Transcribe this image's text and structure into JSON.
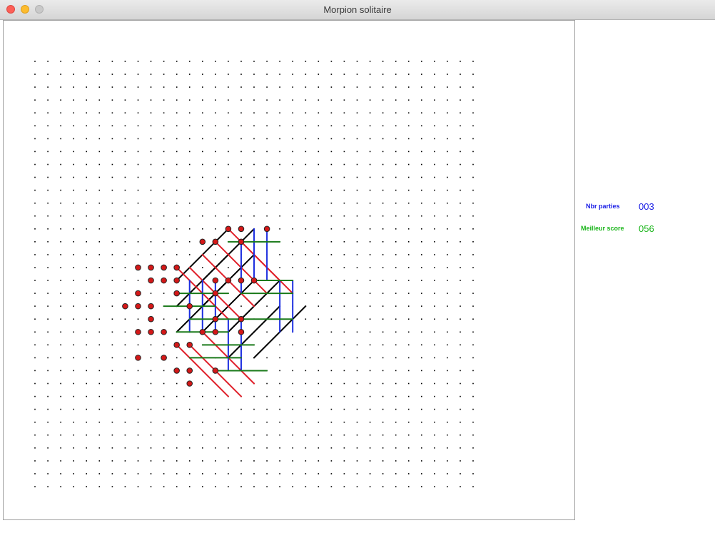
{
  "window": {
    "title": "Morpion solitaire"
  },
  "stats": {
    "games_label": "Nbr parties",
    "games_value": "003",
    "best_label": "Meilleur score",
    "best_value": "056"
  },
  "colors": {
    "games": "#1c20e6",
    "best": "#1bb51b",
    "line_vertical": "#1c2ee0",
    "line_horizontal": "#1a7a1a",
    "line_diag_down": "#e0202a",
    "line_diag_up": "#000000",
    "point_fill": "#d41818"
  },
  "board": {
    "grid_cols": 35,
    "grid_rows": 34,
    "lines": [
      {
        "from": [
          11,
          17
        ],
        "to": [
          15,
          13
        ],
        "dir": "diag-up"
      },
      {
        "from": [
          11,
          19
        ],
        "to": [
          15,
          15
        ],
        "dir": "diag-up"
      },
      {
        "from": [
          11,
          21
        ],
        "to": [
          15,
          17
        ],
        "dir": "diag-up"
      },
      {
        "from": [
          13,
          17
        ],
        "to": [
          17,
          13
        ],
        "dir": "diag-up"
      },
      {
        "from": [
          13,
          19
        ],
        "to": [
          17,
          15
        ],
        "dir": "diag-up"
      },
      {
        "from": [
          13,
          21
        ],
        "to": [
          17,
          17
        ],
        "dir": "diag-up"
      },
      {
        "from": [
          15,
          21
        ],
        "to": [
          19,
          17
        ],
        "dir": "diag-up"
      },
      {
        "from": [
          15,
          23
        ],
        "to": [
          19,
          19
        ],
        "dir": "diag-up"
      },
      {
        "from": [
          17,
          23
        ],
        "to": [
          21,
          19
        ],
        "dir": "diag-up"
      },
      {
        "from": [
          11,
          16
        ],
        "to": [
          15,
          20
        ],
        "dir": "diag-down"
      },
      {
        "from": [
          12,
          16
        ],
        "to": [
          16,
          20
        ],
        "dir": "diag-down"
      },
      {
        "from": [
          13,
          15
        ],
        "to": [
          17,
          19
        ],
        "dir": "diag-down"
      },
      {
        "from": [
          14,
          14
        ],
        "to": [
          18,
          18
        ],
        "dir": "diag-down"
      },
      {
        "from": [
          15,
          13
        ],
        "to": [
          19,
          17
        ],
        "dir": "diag-down"
      },
      {
        "from": [
          16,
          14
        ],
        "to": [
          20,
          18
        ],
        "dir": "diag-down"
      },
      {
        "from": [
          11,
          22
        ],
        "to": [
          15,
          26
        ],
        "dir": "diag-down"
      },
      {
        "from": [
          12,
          22
        ],
        "to": [
          16,
          26
        ],
        "dir": "diag-down"
      },
      {
        "from": [
          13,
          21
        ],
        "to": [
          17,
          25
        ],
        "dir": "diag-down"
      },
      {
        "from": [
          17,
          13
        ],
        "to": [
          17,
          17
        ],
        "dir": "vertical"
      },
      {
        "from": [
          16,
          14
        ],
        "to": [
          16,
          18
        ],
        "dir": "vertical"
      },
      {
        "from": [
          18,
          13
        ],
        "to": [
          18,
          17
        ],
        "dir": "vertical"
      },
      {
        "from": [
          12,
          17
        ],
        "to": [
          12,
          21
        ],
        "dir": "vertical"
      },
      {
        "from": [
          13,
          17
        ],
        "to": [
          13,
          21
        ],
        "dir": "vertical"
      },
      {
        "from": [
          14,
          17
        ],
        "to": [
          14,
          21
        ],
        "dir": "vertical"
      },
      {
        "from": [
          15,
          20
        ],
        "to": [
          15,
          24
        ],
        "dir": "vertical"
      },
      {
        "from": [
          16,
          20
        ],
        "to": [
          16,
          24
        ],
        "dir": "vertical"
      },
      {
        "from": [
          19,
          17
        ],
        "to": [
          19,
          21
        ],
        "dir": "vertical"
      },
      {
        "from": [
          20,
          17
        ],
        "to": [
          20,
          21
        ],
        "dir": "vertical"
      },
      {
        "from": [
          15,
          14
        ],
        "to": [
          19,
          14
        ],
        "dir": "horizontal"
      },
      {
        "from": [
          11,
          18
        ],
        "to": [
          15,
          18
        ],
        "dir": "horizontal"
      },
      {
        "from": [
          16,
          18
        ],
        "to": [
          20,
          18
        ],
        "dir": "horizontal"
      },
      {
        "from": [
          10,
          19
        ],
        "to": [
          14,
          19
        ],
        "dir": "horizontal"
      },
      {
        "from": [
          12,
          20
        ],
        "to": [
          16,
          20
        ],
        "dir": "horizontal"
      },
      {
        "from": [
          16,
          20
        ],
        "to": [
          20,
          20
        ],
        "dir": "horizontal"
      },
      {
        "from": [
          11,
          21
        ],
        "to": [
          15,
          21
        ],
        "dir": "horizontal"
      },
      {
        "from": [
          13,
          22
        ],
        "to": [
          17,
          22
        ],
        "dir": "horizontal"
      },
      {
        "from": [
          12,
          23
        ],
        "to": [
          16,
          23
        ],
        "dir": "horizontal"
      },
      {
        "from": [
          14,
          24
        ],
        "to": [
          18,
          24
        ],
        "dir": "horizontal"
      },
      {
        "from": [
          17,
          17
        ],
        "to": [
          20,
          17
        ],
        "dir": "horizontal"
      }
    ],
    "points": [
      [
        15,
        13
      ],
      [
        16,
        13
      ],
      [
        18,
        13
      ],
      [
        13,
        14
      ],
      [
        14,
        14
      ],
      [
        16,
        14
      ],
      [
        8,
        16
      ],
      [
        9,
        16
      ],
      [
        10,
        16
      ],
      [
        11,
        16
      ],
      [
        9,
        17
      ],
      [
        10,
        17
      ],
      [
        11,
        17
      ],
      [
        14,
        17
      ],
      [
        15,
        17
      ],
      [
        16,
        17
      ],
      [
        17,
        17
      ],
      [
        8,
        18
      ],
      [
        11,
        18
      ],
      [
        14,
        18
      ],
      [
        7,
        19
      ],
      [
        8,
        19
      ],
      [
        9,
        19
      ],
      [
        12,
        19
      ],
      [
        9,
        20
      ],
      [
        14,
        20
      ],
      [
        16,
        20
      ],
      [
        8,
        21
      ],
      [
        9,
        21
      ],
      [
        10,
        21
      ],
      [
        13,
        21
      ],
      [
        14,
        21
      ],
      [
        16,
        21
      ],
      [
        11,
        22
      ],
      [
        12,
        22
      ],
      [
        8,
        23
      ],
      [
        10,
        23
      ],
      [
        11,
        24
      ],
      [
        12,
        24
      ],
      [
        14,
        24
      ],
      [
        12,
        25
      ]
    ]
  }
}
